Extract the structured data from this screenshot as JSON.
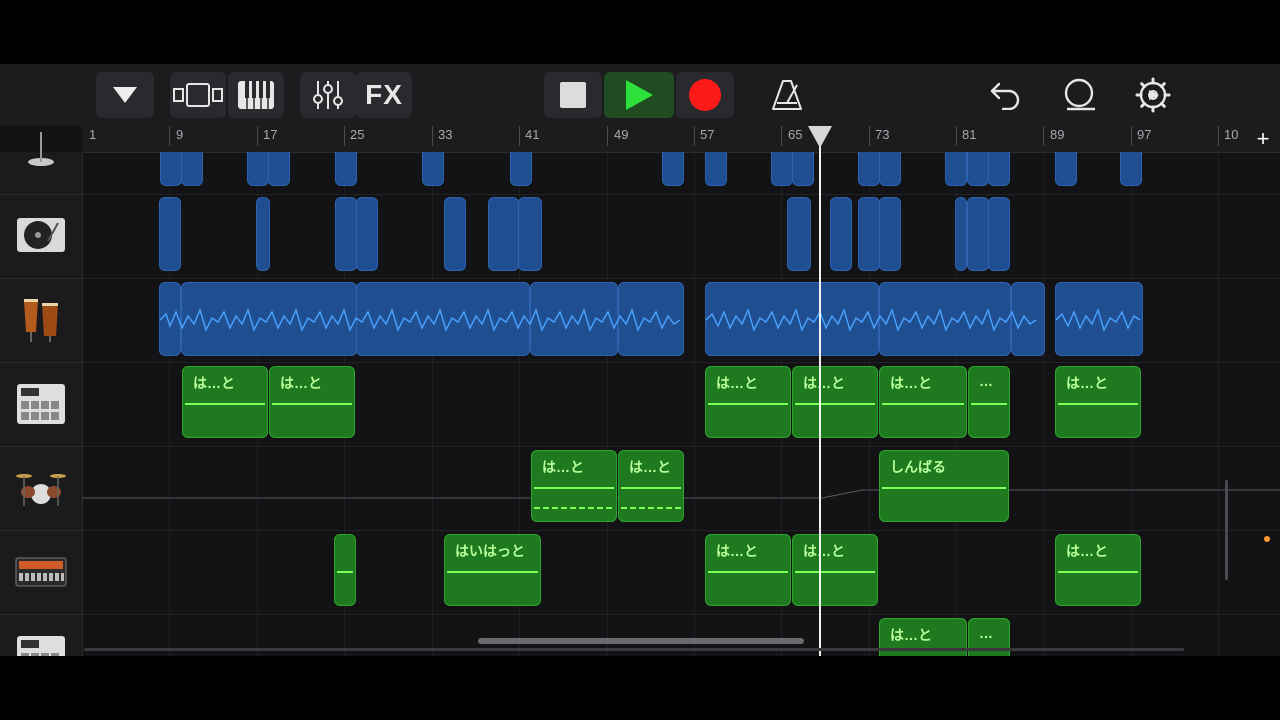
{
  "toolbar": {
    "fx_label": "FX"
  },
  "ruler": {
    "bars": [
      "1",
      "9",
      "17",
      "25",
      "33",
      "41",
      "49",
      "57",
      "65",
      "73",
      "81",
      "89",
      "97",
      "10"
    ]
  },
  "tracks": [
    {
      "name": "cymbal-track",
      "icon": "cymbal-icon"
    },
    {
      "name": "turntable-track",
      "icon": "turntable-icon"
    },
    {
      "name": "conga-track",
      "icon": "conga-drums-icon"
    },
    {
      "name": "drum-machine-track",
      "icon": "drum-machine-icon"
    },
    {
      "name": "drum-kit-track",
      "icon": "drum-kit-icon"
    },
    {
      "name": "beat-sequencer-track",
      "icon": "beat-sequencer-icon"
    },
    {
      "name": "drum-machine-2-track",
      "icon": "drum-machine-icon"
    }
  ],
  "regions": {
    "r3_1": "は…と",
    "r3_2": "は…と",
    "r3_3": "は…と",
    "r3_4": "は…と",
    "r3_5": "は…と",
    "r3_6": "…",
    "r3_7": "は…と",
    "r4_1": "は…と",
    "r4_2": "は…と",
    "r4_3": "しんばる",
    "r5_2": "はいはっと",
    "r5_3": "は…と",
    "r5_4": "は…と",
    "r5_5": "は…と",
    "r6_1": "は…と",
    "r6_2": "…"
  },
  "colors": {
    "audio_region": "#1f4f91",
    "midi_region": "#1f7a1f",
    "midi_text": "#b9ff9a",
    "play": "#2ee03a",
    "record": "#ff1a1a"
  }
}
